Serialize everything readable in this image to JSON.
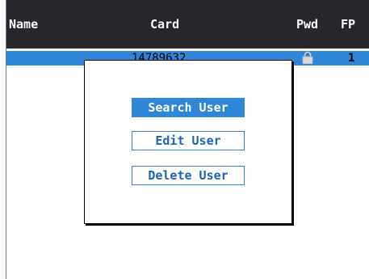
{
  "header": {
    "columns": {
      "name": "Name",
      "card": "Card",
      "pwd": "Pwd",
      "fp": "FP"
    }
  },
  "rows": [
    {
      "card": "14789632",
      "has_password": true,
      "fp": "1"
    }
  ],
  "menu": {
    "items": [
      {
        "label": "Search User",
        "selected": true
      },
      {
        "label": "Edit User",
        "selected": false
      },
      {
        "label": "Delete User",
        "selected": false
      }
    ]
  },
  "colors": {
    "header_bg": "#27262c",
    "highlight": "#2f86d6",
    "menu_text": "#1a63b5"
  }
}
